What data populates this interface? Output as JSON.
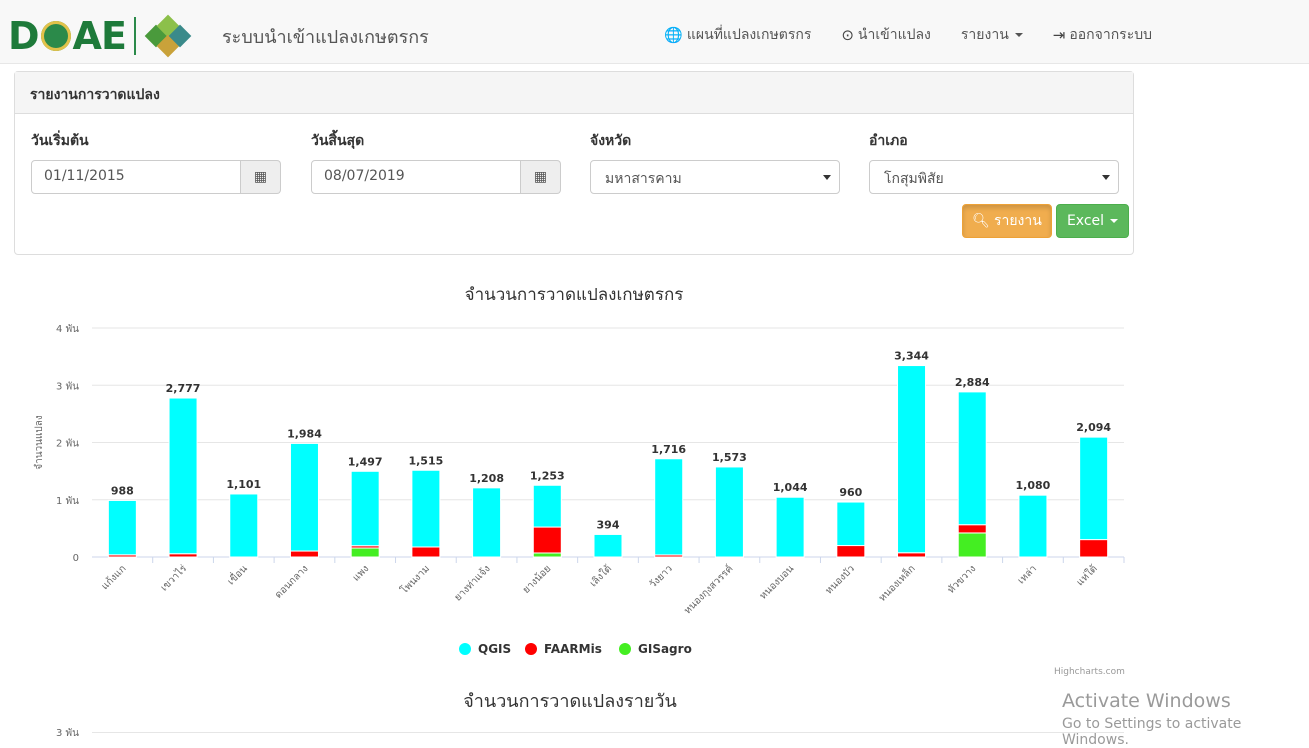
{
  "header": {
    "site_title": "ระบบนำเข้าแปลงเกษตรกร",
    "nav": [
      {
        "label": "แผนที่แปลงเกษตรกร",
        "icon": "globe-icon"
      },
      {
        "label": "นำเข้าแปลง",
        "icon": "upload-circle-icon"
      },
      {
        "label": "รายงาน",
        "icon": "chevron-down-icon"
      },
      {
        "label": "ออกจากระบบ",
        "icon": "logout-icon"
      }
    ]
  },
  "panel": {
    "title": "รายงานการวาดแปลง",
    "start_label": "วันเริ่มต้น",
    "start_value": "01/11/2015",
    "end_label": "วันสิ้นสุด",
    "end_value": "08/07/2019",
    "province_label": "จังหวัด",
    "province_value": "มหาสารคาม",
    "district_label": "อำเภอ",
    "district_value": "โกสุมพิสัย",
    "report_button": "รายงาน",
    "excel_button": "Excel"
  },
  "chart_data": {
    "type": "bar",
    "stacked": true,
    "title": "จำนวนการวาดแปลงเกษตรกร",
    "ylabel": "จำนวนแปลง",
    "ylim": [
      0,
      4000
    ],
    "y_ticks": [
      "0",
      "1 พัน",
      "2 พัน",
      "3 พัน",
      "4 พัน"
    ],
    "categories": [
      "แก้งแก",
      "เขวาไร่",
      "เขื่อน",
      "ดอนกลาง",
      "แพง",
      "โพนงาม",
      "ยางท่าแจ้ง",
      "ยางน้อย",
      "เลิงใต้",
      "วังยาว",
      "หนองกุงสวรรค์",
      "หนองบอน",
      "หนองบัว",
      "หนองเหล็ก",
      "หัวขวาง",
      "เหล่า",
      "แห่ใต้"
    ],
    "totals": [
      "988",
      "2,777",
      "1,101",
      "1,984",
      "1,497",
      "1,515",
      "1,208",
      "1,253",
      "394",
      "1,716",
      "1,573",
      "1,044",
      "960",
      "3,344",
      "2,884",
      "1,080",
      "2,094"
    ],
    "series": [
      {
        "name": "QGIS",
        "color": "#00ffff",
        "values": [
          950,
          2720,
          1101,
          1880,
          1300,
          1340,
          1208,
          730,
          394,
          1680,
          1573,
          1044,
          760,
          3270,
          2320,
          1080,
          1790
        ]
      },
      {
        "name": "FAARMis",
        "color": "#ff0000",
        "values": [
          38,
          57,
          0,
          104,
          40,
          175,
          0,
          453,
          0,
          36,
          0,
          0,
          200,
          74,
          144,
          0,
          304
        ]
      },
      {
        "name": "GISagro",
        "color": "#44ee22",
        "values": [
          0,
          0,
          0,
          0,
          157,
          0,
          0,
          70,
          0,
          0,
          0,
          0,
          0,
          0,
          420,
          0,
          0
        ]
      }
    ],
    "legend_position": "bottom-center",
    "grid": true,
    "credits": "Highcharts.com"
  },
  "chart2": {
    "title": "จำนวนการวาดแปลงรายวัน",
    "first_tick": "3 พัน"
  },
  "watermark": {
    "line1": "Activate Windows",
    "line2": "Go to Settings to activate Windows."
  }
}
